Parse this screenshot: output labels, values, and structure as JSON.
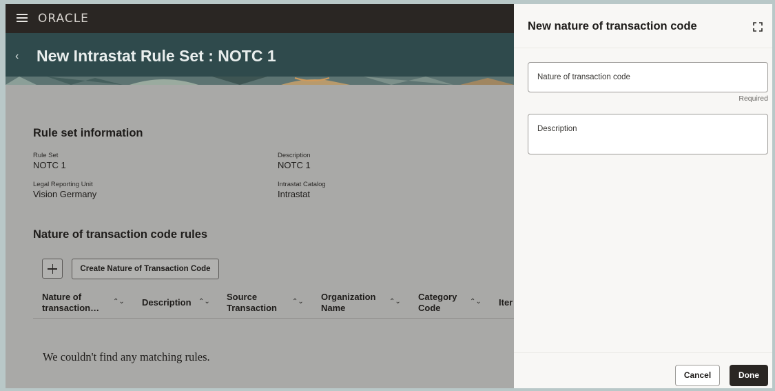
{
  "header": {
    "logo": "ORACLE"
  },
  "page": {
    "back_glyph": "‹",
    "title": "New Intrastat Rule Set : NOTC 1"
  },
  "rule_set_info": {
    "heading": "Rule set information",
    "fields": [
      {
        "label": "Rule Set",
        "value": "NOTC 1"
      },
      {
        "label": "Description",
        "value": "NOTC 1"
      },
      {
        "label": "Legal Reporting Unit",
        "value": "Vision Germany"
      },
      {
        "label": "Intrastat Catalog",
        "value": "Intrastat"
      }
    ]
  },
  "rules": {
    "heading": "Nature of transaction code rules",
    "create_button": "Create Nature of Transaction Code",
    "columns": [
      {
        "line1": "Nature of",
        "line2": "transaction…"
      },
      {
        "line1": "Description",
        "line2": ""
      },
      {
        "line1": "Source",
        "line2": "Transaction"
      },
      {
        "line1": "Organization",
        "line2": "Name"
      },
      {
        "line1": "Category",
        "line2": "Code"
      },
      {
        "line1": "Iter",
        "line2": ""
      }
    ],
    "sort_glyph": "⌃⌄",
    "empty_message": "We couldn't find any matching rules."
  },
  "drawer": {
    "title": "New nature of transaction code",
    "fields": {
      "code_label": "Nature of transaction code",
      "required_text": "Required",
      "description_label": "Description"
    },
    "cancel": "Cancel",
    "done": "Done"
  },
  "icons": [
    "menu-icon",
    "back-icon",
    "plus-icon",
    "sort-icon",
    "expand-icon"
  ],
  "colors": {
    "topbar": "#2a2623",
    "page_header": "#2f4a4c",
    "primary_button": "#2a2623"
  }
}
